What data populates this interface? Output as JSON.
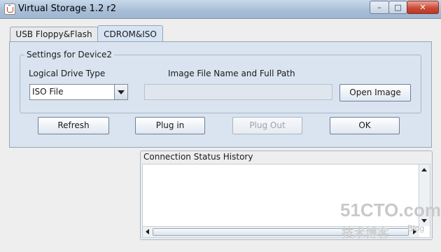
{
  "window": {
    "title": "Virtual Storage 1.2 r2",
    "controls": {
      "minimize": "–",
      "maximize": "□",
      "close": "✕"
    }
  },
  "tabs": [
    {
      "label": "USB Floppy&Flash",
      "selected": false
    },
    {
      "label": "CDROM&ISO",
      "selected": true
    }
  ],
  "settings": {
    "group_title": "Settings for Device2",
    "logical_drive_label": "Logical Drive Type",
    "image_path_label": "Image File Name and Full Path",
    "drive_type_value": "ISO File",
    "image_path_value": "",
    "open_image_label": "Open Image"
  },
  "actions": {
    "refresh": "Refresh",
    "plug_in": "Plug in",
    "plug_out": "Plug Out",
    "ok": "OK"
  },
  "status": {
    "title": "Connection Status History",
    "content": ""
  },
  "watermark": {
    "main": "51CTO.com",
    "sub": "技术博客",
    "blog": "Blog"
  },
  "colors": {
    "titlebar": "#a9bfd8",
    "panel": "#d9e4f0",
    "close_button": "#cc4b37"
  }
}
